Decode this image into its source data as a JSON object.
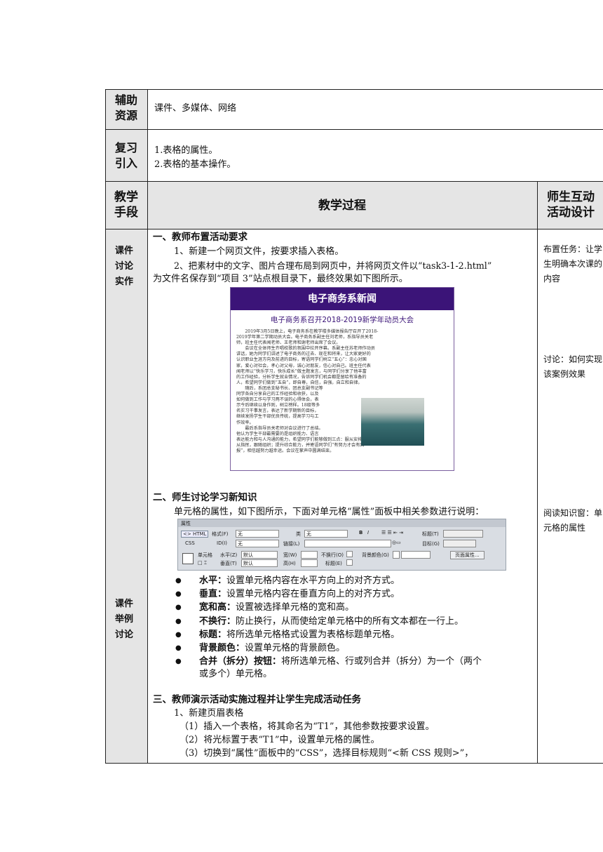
{
  "rows": {
    "aux": {
      "label_l1": "辅助",
      "label_l2": "资源",
      "content": "课件、多媒体、网络"
    },
    "review": {
      "label_l1": "复习",
      "label_l2": "引入",
      "items": [
        "1.表格的属性。",
        "2.表格的基本操作。"
      ]
    },
    "header": {
      "left_l1": "教学",
      "left_l2": "手段",
      "center": "教学过程",
      "right_l1": "师生互动",
      "right_l2": "活动设计"
    }
  },
  "side_labels": {
    "first": [
      "课件",
      "讨论",
      "实作"
    ],
    "second": [
      "课件",
      "举例",
      "讨论"
    ]
  },
  "section1": {
    "heading": "一、教师布置活动要求",
    "p1": "1、新建一个网页文件，按要求插入表格。",
    "p2a": "2、把素材中的文字、图片合理布局到网页中，并将网页文件以“task3-1-2.html”",
    "p2b": "为文件名保存到“项目 3”站点根目录下，最终效果如下图所示。"
  },
  "news": {
    "title": "电子商务系新闻",
    "subtitle": "电子商务系召开2018-2019新学年动员大会",
    "body": [
      "　　2019年3月5日晚上，电子商务系在教学楼多媒体报告厅召开了2018-",
      "2019学年第二学期动员大会。电子商务系副主任刘老师，系指导员关老",
      "师，班主任代表闻老师、王老师和谢老师出席了会议。",
      "　　会议在全体师生齐唱校歌的氛围中拉开序幕。系副主任苏老师作动员",
      "讲话，她为同学们讲述了电子商务的过去、现在和将来，让大家更好的",
      "认识职业生涯方向及前进的目标，寄语同学们树立“五心”：忠心对国",
      "家，爱心对社会，孝心对父母，诚心对朋友，信心对自己。班主任代表",
      "闻老师以“快乐学习，快乐成长”做主题发言，与同学们分享了他丰富",
      "的工作经验，分析学生就业情况，告诉同学们机会都是留给有准备的",
      "人，希望同学们做到“五自”，即自尊，自信，自强，自立和自律。",
      "　　随后，系团总支秘书长、团总支副书记等",
      "同学各自分享自己的工作经验和收获，以及",
      "如何做到工作与学习两不误的心得体会，表",
      "示今后继续以身作则，树立榜样。18级等多",
      "名实习干事发言，表达了新学期新的目标，",
      "继续发扬学生干部优良传统，提高学习与工",
      "作效率。",
      "　　最后系指导员关老师对会议进行了总结。",
      "他认为学生干部最需要的是组织能力、语言",
      "表达能力和与人沟通的能力，希望同学们能够做到三点：服从安排；听",
      "从指挥，跟随组织；提升综合能力，并寄语同学们“有努力才会有回",
      "报”，相信越努力越幸运。会议在掌声中圆满结束。"
    ]
  },
  "section2": {
    "heading": "二、师生讨论学习新知识",
    "intro": "单元格的属性，如下图所示，下面对单元格“属性”面板中相关参数进行说明：",
    "bullets": [
      {
        "term": "水平：",
        "desc": "设置单元格内容在水平方向上的对齐方式。"
      },
      {
        "term": "垂直：",
        "desc": "设置单元格内容在垂直方向上的对齐方式。"
      },
      {
        "term": "宽和高：",
        "desc": "设置被选择单元格的宽和高。"
      },
      {
        "term": "不换行：",
        "desc": "防止换行，从而使给定单元格中的所有文本都在一行上。"
      },
      {
        "term": "标题：",
        "desc": "将所选单元格格式设置为表格标题单元格。"
      },
      {
        "term": "背景颜色：",
        "desc": "设置单元格的背景颜色。"
      },
      {
        "term": "合并（拆分）按钮：",
        "desc": "将所选单元格、行或列合并（拆分）为一个（两个"
      }
    ],
    "bullet_cont": "或多个）单元格。",
    "bullet_glyph": "●"
  },
  "panel": {
    "tab": "属性",
    "html": "<> HTML",
    "css": "CSS",
    "format_label": "格式(F)",
    "format_val": "无",
    "class_label": "类",
    "class_val": "无",
    "id_label": "ID(I)",
    "id_val": "无",
    "link_label": "链接(L)",
    "title_label": "标题(T)",
    "target_label": "目标(G)",
    "cell_label": "单元格",
    "horz_label": "水平(Z)",
    "horz_val": "默认",
    "vert_label": "垂直(T)",
    "vert_val": "默认",
    "width_label": "宽(W)",
    "height_label": "高(H)",
    "nowrap_label": "不换行(O)",
    "header_label": "标题(E)",
    "bg_label": "背景颜色(G)",
    "page_props": "页面属性..."
  },
  "section3": {
    "heading": "三、教师演示活动实施过程并让学生完成活动任务",
    "p1": "1、新建页眉表格",
    "p2": "（1）插入一个表格，将其命名为“T1”，其他参数按要求设置。",
    "p3": "（2）将光标置于表“T1”中，设置单元格的属性。",
    "p4": "（3）切换到“属性”面板中的“CSS”，选择目标规则“<新 CSS 规则>”，"
  },
  "right_notes": {
    "n1": "布置任务：让学生明确本次课的内容",
    "n2": "讨论：如何实现该案例效果",
    "n3": "阅读知识窗：单元格的属性"
  }
}
